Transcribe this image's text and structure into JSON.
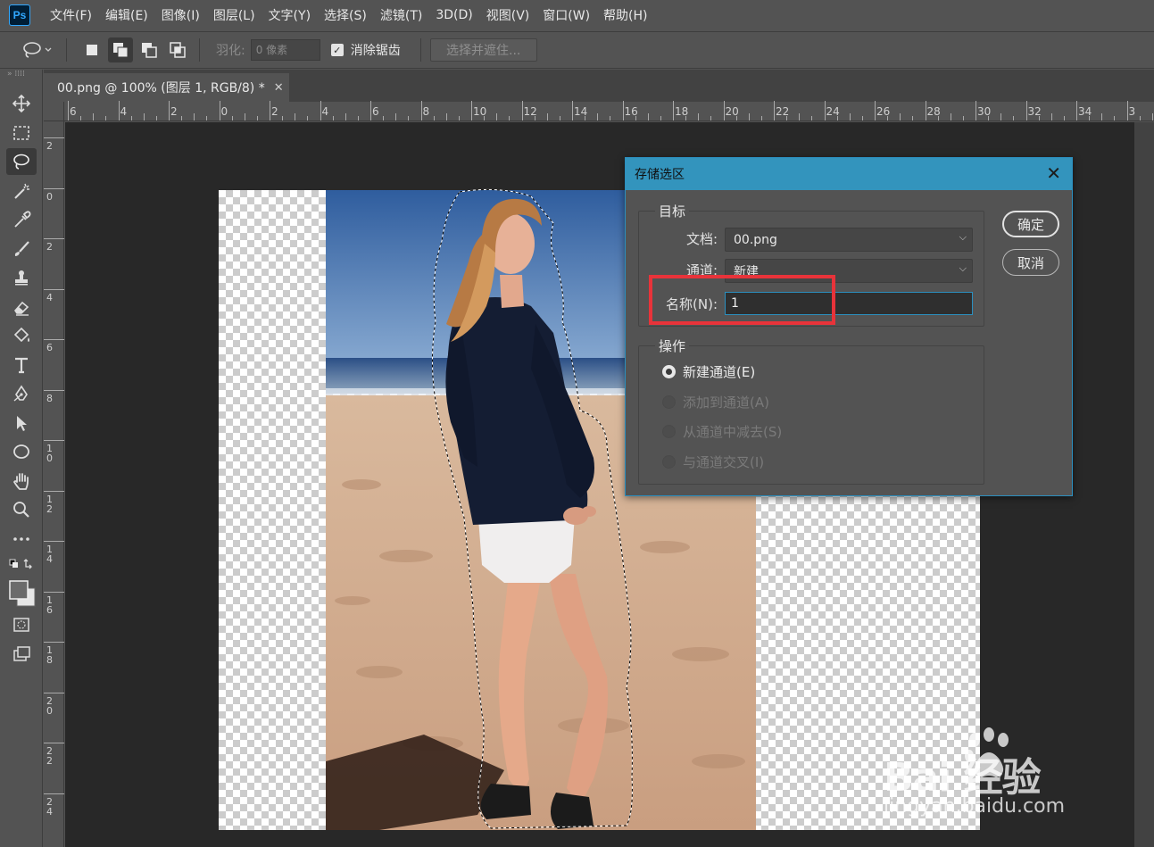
{
  "app": {
    "logo_text": "Ps"
  },
  "menu": [
    "文件(F)",
    "编辑(E)",
    "图像(I)",
    "图层(L)",
    "文字(Y)",
    "选择(S)",
    "滤镜(T)",
    "3D(D)",
    "视图(V)",
    "窗口(W)",
    "帮助(H)"
  ],
  "options": {
    "feather_label": "羽化:",
    "feather_value": "0 像素",
    "antialias_label": "消除锯齿",
    "antialias_checked": true,
    "select_mask_label": "选择并遮住..."
  },
  "tab": {
    "title": "00.png @ 100% (图层 1, RGB/8) *",
    "close": "✕"
  },
  "ruler_top": [
    "6",
    "4",
    "2",
    "0",
    "2",
    "4",
    "6",
    "8",
    "10",
    "12",
    "14",
    "16",
    "18",
    "20",
    "22",
    "24",
    "26",
    "28",
    "30",
    "32",
    "34",
    "3"
  ],
  "ruler_left": [
    "2",
    "0",
    "2",
    "4",
    "6",
    "8",
    "10",
    "12",
    "14",
    "16",
    "18",
    "20",
    "22",
    "24"
  ],
  "dialog": {
    "title": "存储选区",
    "close": "✕",
    "target_group": "目标",
    "doc_label": "文档:",
    "doc_value": "00.png",
    "channel_label": "通道:",
    "channel_value": "新建",
    "name_label": "名称(N):",
    "name_value": "1",
    "op_group": "操作",
    "ops": [
      {
        "label": "新建通道(E)",
        "selected": true,
        "enabled": true
      },
      {
        "label": "添加到通道(A)",
        "selected": false,
        "enabled": false
      },
      {
        "label": "从通道中减去(S)",
        "selected": false,
        "enabled": false
      },
      {
        "label": "与通道交叉(I)",
        "selected": false,
        "enabled": false
      }
    ],
    "ok": "确定",
    "cancel": "取消"
  },
  "watermark": {
    "main": "Bai 经验",
    "sub": "jingyan.baidu.com"
  },
  "colors": {
    "accent": "#3394bd",
    "highlight": "#e8333a",
    "workspace": "#282828",
    "panel": "#535353"
  }
}
